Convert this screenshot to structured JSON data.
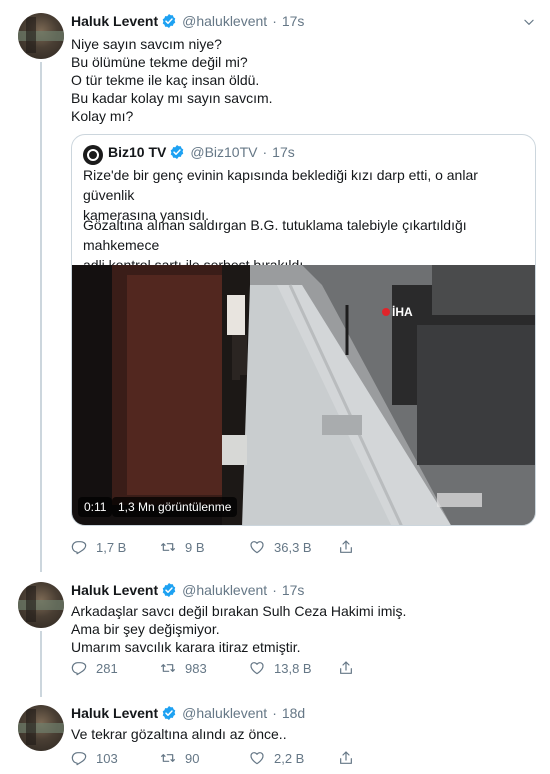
{
  "tweets": [
    {
      "name": "Haluk Levent",
      "handle": "@haluklevent",
      "time": "17s",
      "lines": [
        "Niye sayın savcım niye?",
        "Bu ölümüne tekme değil mi?",
        "O tür tekme ile kaç insan öldü.",
        "Bu kadar kolay mı sayın savcım.",
        "Kolay mı?"
      ],
      "replies": "1,7 B",
      "retweets": "9 B",
      "likes": "36,3 B"
    },
    {
      "name": "Haluk Levent",
      "handle": "@haluklevent",
      "time": "17s",
      "lines": [
        "Arkadaşlar savcı değil bırakan Sulh Ceza Hakimi imiş.",
        "Ama bir şey değişmiyor.",
        "Umarım savcılık karara itiraz etmiştir."
      ],
      "replies": "281",
      "retweets": "983",
      "likes": "13,8 B"
    },
    {
      "name": "Haluk Levent",
      "handle": "@haluklevent",
      "time": "18d",
      "lines": [
        "Ve tekrar gözaltına alındı az önce.."
      ],
      "replies": "103",
      "retweets": "90",
      "likes": "2,2 B"
    }
  ],
  "quote": {
    "name": "Biz10 TV",
    "handle": "@Biz10TV",
    "time": "17s",
    "para1": [
      "Rize'de bir genç evinin kapısında beklediği kızı darp etti, o anlar güvenlik",
      "kamerasına yansıdı."
    ],
    "para2": [
      "Gözaltına alınan saldırgan B.G. tutuklama talebiyle çıkartıldığı mahkemece",
      "adli kontrol şartı ile serbest bırakıldı."
    ],
    "video": {
      "duration": "0:11",
      "views": "1,3 Mn görüntülenme",
      "watermark": "İHA"
    }
  },
  "icons": [
    "verified-badge-icon",
    "chevron-down-icon",
    "reply-icon",
    "retweet-icon",
    "like-icon",
    "share-icon"
  ],
  "colors": {
    "verified": "#1da1f2",
    "secondary_text": "#657786",
    "border": "#ccd6dd"
  }
}
